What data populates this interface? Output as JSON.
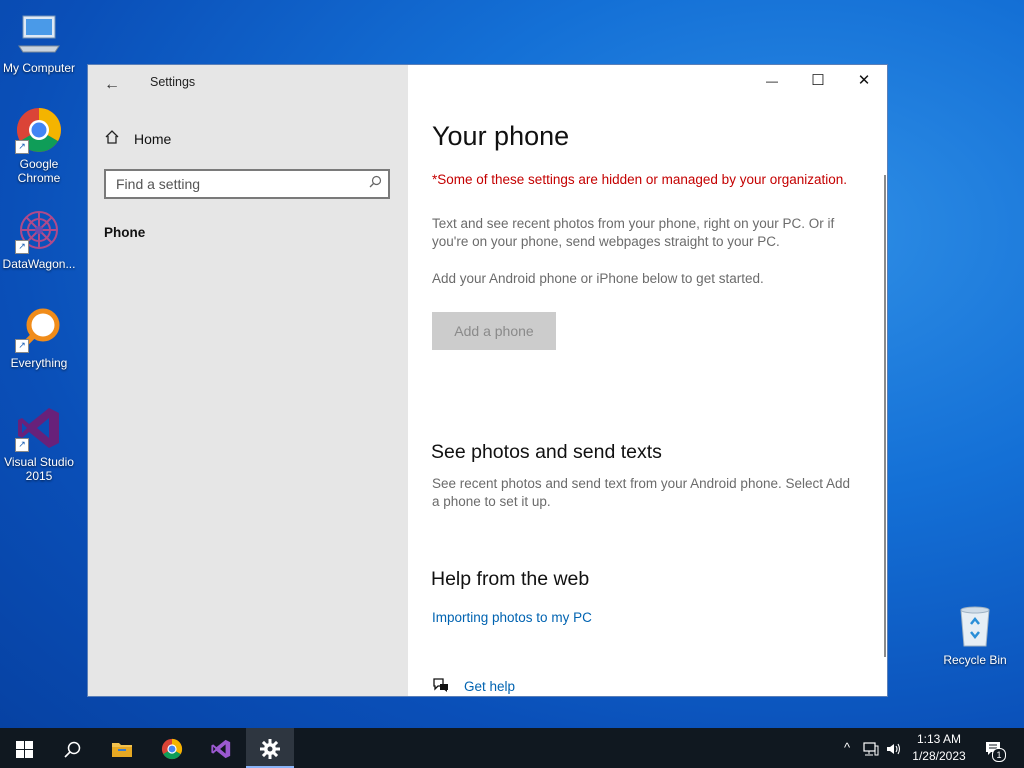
{
  "desktop": {
    "icons": [
      {
        "label": "My Computer"
      },
      {
        "label": "Google Chrome"
      },
      {
        "label": "DataWagon..."
      },
      {
        "label": "Everything"
      },
      {
        "label": "Visual Studio 2015"
      },
      {
        "label": "Recycle Bin"
      }
    ]
  },
  "window": {
    "title": "Settings",
    "controls": {
      "minimize": "—",
      "maximize": "☐",
      "close": "✕"
    }
  },
  "sidebar": {
    "home_label": "Home",
    "search_placeholder": "Find a setting",
    "items": [
      {
        "label": "Phone"
      }
    ]
  },
  "main": {
    "title": "Your phone",
    "managed_notice": "*Some of these settings are hidden or managed by your organization.",
    "intro": "Text and see recent photos from your phone, right on your PC. Or if you're on your phone, send webpages straight to your PC.",
    "get_started": "Add your Android phone or iPhone below to get started.",
    "add_phone_button": "Add a phone",
    "section_photos_title": "See photos and send texts",
    "section_photos_text": "See recent photos and send text from your Android phone. Select Add a phone to set it up.",
    "help_title": "Help from the web",
    "help_link": "Importing photos to my PC",
    "get_help": "Get help"
  },
  "taskbar": {
    "time": "1:13 AM",
    "date": "1/28/2023",
    "notification_count": "1"
  },
  "colors": {
    "managed_text": "#c40000",
    "link": "#0063b1",
    "sidebar_bg": "#e6e6e6",
    "taskbar_bg": "#101820"
  }
}
